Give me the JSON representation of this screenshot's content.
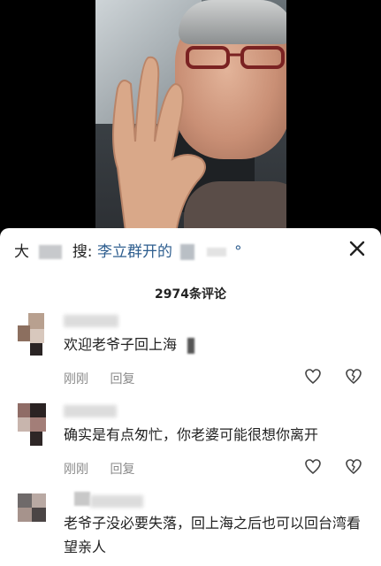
{
  "search": {
    "prefix_fragment": "大",
    "label": "搜:",
    "query": "李立群开的",
    "query_suffix": "°"
  },
  "comments_header": {
    "count_text": "2974条评论"
  },
  "comments": [
    {
      "name": "耀",
      "text": "欢迎老爷子回上海",
      "time": "刚刚",
      "reply": "回复"
    },
    {
      "name": "",
      "text": "确实是有点匆忙，你老婆可能很想你离开",
      "time": "刚刚",
      "reply": "回复"
    },
    {
      "name": "",
      "text": "老爷子没必要失落，回上海之后也可以回台湾看望亲人",
      "time": "",
      "reply": ""
    }
  ],
  "icons": {
    "close": "close-icon",
    "like": "heart-icon",
    "dislike": "broken-heart-icon"
  },
  "colors": {
    "link": "#2e5e8f",
    "meta": "#8a8a8a"
  }
}
